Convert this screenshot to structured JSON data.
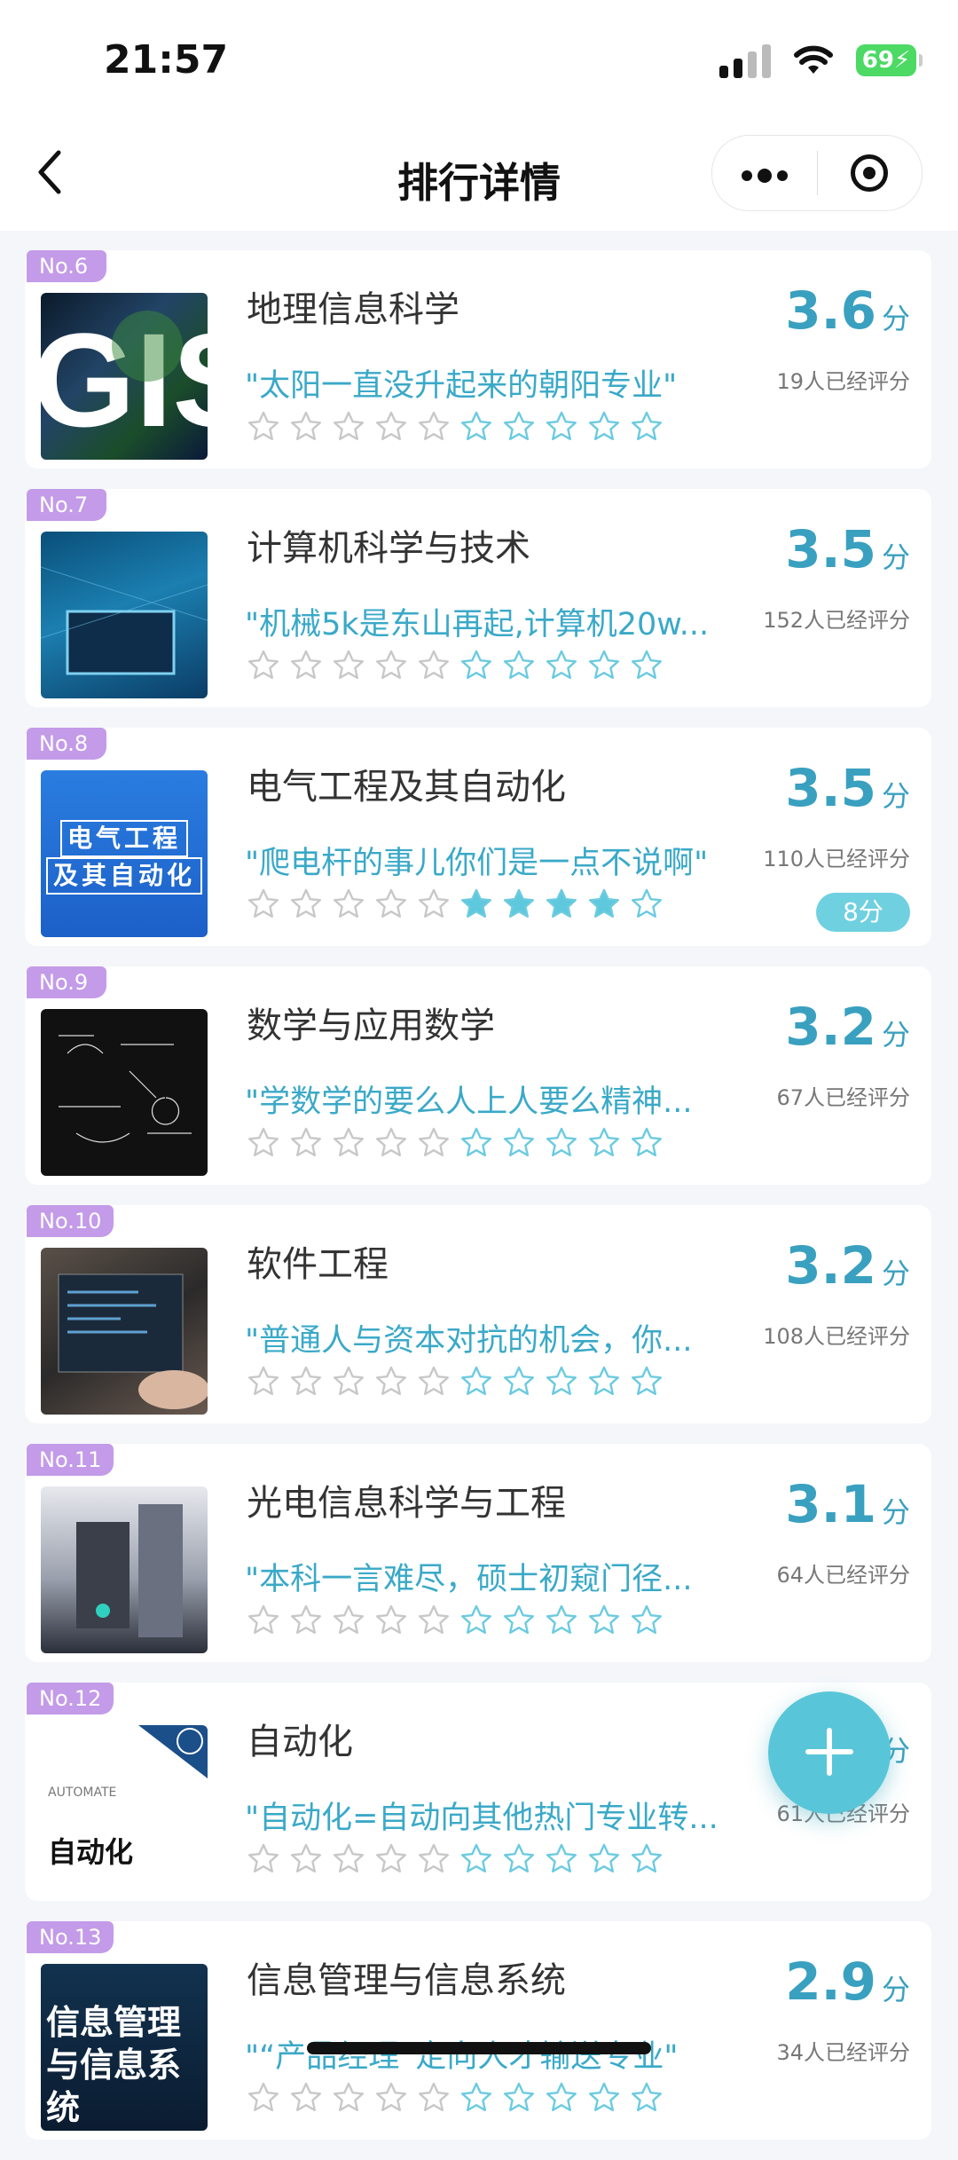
{
  "status_bar": {
    "time": "21:57",
    "battery": "69"
  },
  "nav": {
    "title": "排行详情"
  },
  "colors": {
    "accent": "#3aa0c0",
    "rank_badge": "#c39be8",
    "fab": "#58c6d8"
  },
  "items": [
    {
      "rank": "No.6",
      "name": "地理信息科学",
      "quote": "\"太阳一直没升起来的朝阳专业\"",
      "score": "3.6",
      "unit": "分",
      "raters": "19人已经评分",
      "my_rating": null,
      "filled_stars": 0
    },
    {
      "rank": "No.7",
      "name": "计算机科学与技术",
      "quote": "\"机械5k是东山再起,计算机20w...",
      "score": "3.5",
      "unit": "分",
      "raters": "152人已经评分",
      "my_rating": null,
      "filled_stars": 0
    },
    {
      "rank": "No.8",
      "name": "电气工程及其自动化",
      "quote": "\"爬电杆的事儿你们是一点不说啊\"",
      "score": "3.5",
      "unit": "分",
      "raters": "110人已经评分",
      "my_rating": "8分",
      "filled_stars": 4,
      "thumb_text": [
        "电气工程",
        "及其自动化"
      ]
    },
    {
      "rank": "No.9",
      "name": "数学与应用数学",
      "quote": "\"学数学的要么人上人要么精神...",
      "score": "3.2",
      "unit": "分",
      "raters": "67人已经评分",
      "my_rating": null,
      "filled_stars": 0
    },
    {
      "rank": "No.10",
      "name": "软件工程",
      "quote": "\"普通人与资本对抗的机会，你...",
      "score": "3.2",
      "unit": "分",
      "raters": "108人已经评分",
      "my_rating": null,
      "filled_stars": 0
    },
    {
      "rank": "No.11",
      "name": "光电信息科学与工程",
      "quote": "\"本科一言难尽，硕士初窥门径...",
      "score": "3.1",
      "unit": "分",
      "raters": "64人已经评分",
      "my_rating": null,
      "filled_stars": 0
    },
    {
      "rank": "No.12",
      "name": "自动化",
      "quote": "\"自动化=自动向其他热门专业转...",
      "score": "",
      "unit": "分",
      "raters": "61人已经评分",
      "my_rating": null,
      "filled_stars": 0,
      "thumb_text": [
        "AUTOMATE",
        "自动化"
      ]
    },
    {
      "rank": "No.13",
      "name": "信息管理与信息系统",
      "quote": "\"“产品经理”定向人才输送专业\"",
      "score": "2.9",
      "unit": "分",
      "raters": "34人已经评分",
      "my_rating": null,
      "filled_stars": 0,
      "thumb_text": [
        "信息管理",
        "与信息系统"
      ]
    }
  ]
}
